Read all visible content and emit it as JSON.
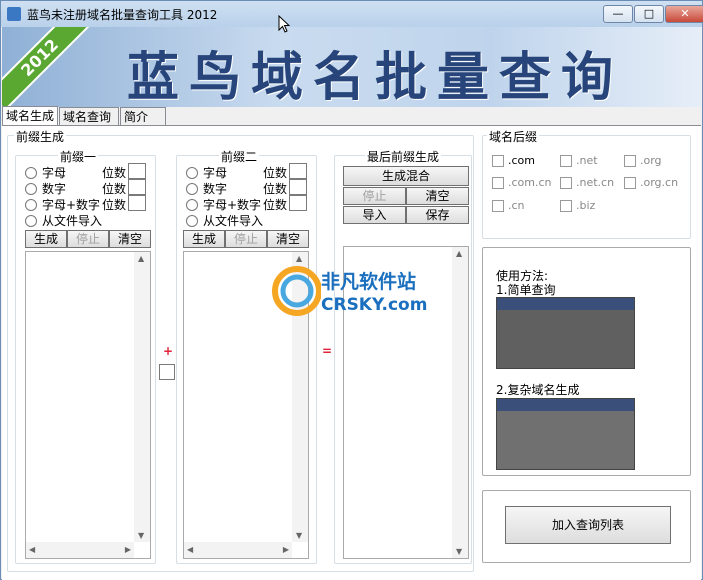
{
  "window": {
    "title": "蓝鸟未注册域名批量查询工具 2012",
    "minimize": "—",
    "maximize": "□",
    "close": "✕"
  },
  "banner": {
    "ribbon": "2012",
    "title": "蓝鸟域名批量查询"
  },
  "tabs": [
    "域名生成",
    "域名查询",
    "简介"
  ],
  "prefix_group": {
    "label": "前缀生成"
  },
  "prefix1": {
    "label": "前缀一",
    "options": [
      "字母",
      "数字",
      "字母+数字",
      "从文件导入"
    ],
    "digits_label": "位数",
    "buttons": {
      "generate": "生成",
      "stop": "停止",
      "clear": "清空"
    }
  },
  "plus": "+",
  "prefix2": {
    "label": "前缀二",
    "options": [
      "字母",
      "数字",
      "字母+数字",
      "从文件导入"
    ],
    "digits_label": "位数",
    "buttons": {
      "generate": "生成",
      "stop": "停止",
      "clear": "清空"
    }
  },
  "equals": "=",
  "final": {
    "label": "最后前缀生成",
    "mix": "生成混合",
    "stop": "停止",
    "clear": "清空",
    "import": "导入",
    "save": "保存"
  },
  "suffix": {
    "label": "域名后缀",
    "items": [
      ".com",
      ".net",
      ".org",
      ".com.cn",
      ".net.cn",
      ".org.cn",
      ".cn",
      ".biz"
    ]
  },
  "help": {
    "title": "使用方法:",
    "step1": "1.简单查询",
    "step2": "2.复杂域名生成"
  },
  "watermark": {
    "name": "非凡软件站",
    "site": "CRSKY.com"
  },
  "add_button": "加入查询列表"
}
